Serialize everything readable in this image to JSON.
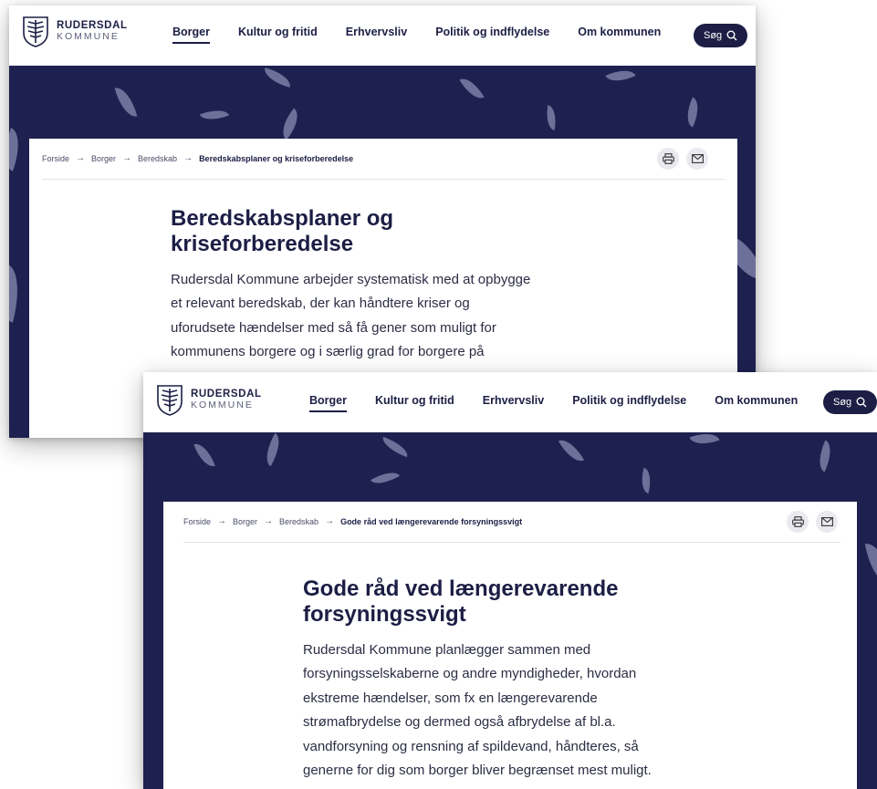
{
  "header": {
    "logo_name": "RUDERSDAL",
    "logo_sub": "KOMMUNE",
    "nav": [
      {
        "label": "Borger",
        "active": true
      },
      {
        "label": "Kultur og fritid",
        "active": false
      },
      {
        "label": "Erhvervsliv",
        "active": false
      },
      {
        "label": "Politik og indflydelse",
        "active": false
      },
      {
        "label": "Om kommunen",
        "active": false
      }
    ],
    "search_label": "Søg",
    "search_icon": "search-icon"
  },
  "colors": {
    "brand_navy": "#1e2150",
    "leaf": "#7b7fa6",
    "tool_bg": "#e9e9ef"
  },
  "page1": {
    "breadcrumb": {
      "items": [
        "Forside",
        "Borger",
        "Beredskab"
      ],
      "current": "Beredskabsplaner og kriseforberedelse"
    },
    "title_lines": [
      "Beredskabsplaner og",
      "kriseforberedelse"
    ],
    "lead_lines": [
      "Rudersdal Kommune arbejder systematisk med at opbygge",
      "et relevant beredskab, der kan håndtere kriser og",
      "uforudsete hændelser med så få gener som muligt for",
      "kommunens borgere og i særlig grad for borgere på"
    ]
  },
  "page2": {
    "breadcrumb": {
      "items": [
        "Forside",
        "Borger",
        "Beredskab"
      ],
      "current": "Gode råd ved længerevarende forsyningssvigt"
    },
    "title_lines": [
      "Gode råd ved længerevarende",
      "forsyningssvigt"
    ],
    "lead_lines": [
      "Rudersdal Kommune planlægger sammen med",
      "forsyningsselskaberne og andre myndigheder, hvordan",
      "ekstreme hændelser, som fx en længerevarende",
      "strømafbrydelse og dermed også afbrydelse af bl.a.",
      "vandforsyning og rensning af spildevand, håndteres, så",
      "generne for dig som borger bliver begrænset mest muligt."
    ]
  },
  "tools": {
    "print_icon": "print-icon",
    "mail_icon": "mail-icon"
  }
}
